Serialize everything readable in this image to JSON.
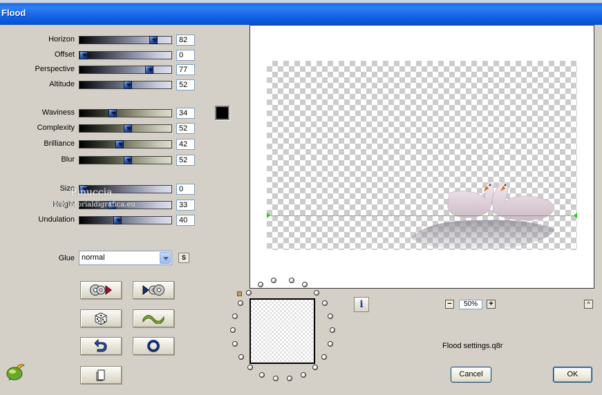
{
  "window": {
    "title": "Flood"
  },
  "sliders": [
    {
      "label": "Horizon",
      "value": "82",
      "level": 82,
      "track": "blue"
    },
    {
      "label": "Offset",
      "value": "0",
      "level": 0,
      "track": "blue"
    },
    {
      "label": "Perspective",
      "value": "77",
      "level": 77,
      "track": "blue"
    },
    {
      "label": "Altitude",
      "value": "52",
      "level": 52,
      "track": "blue"
    },
    {
      "label": "Waviness",
      "value": "34",
      "level": 34,
      "track": "olive"
    },
    {
      "label": "Complexity",
      "value": "52",
      "level": 52,
      "track": "olive"
    },
    {
      "label": "Brilliance",
      "value": "42",
      "level": 42,
      "track": "olive"
    },
    {
      "label": "Blur",
      "value": "52",
      "level": 52,
      "track": "olive"
    },
    {
      "label": "Size",
      "value": "0",
      "level": 0,
      "track": "blue"
    },
    {
      "label": "Height",
      "value": "33",
      "level": 33,
      "track": "blue"
    },
    {
      "label": "Undulation",
      "value": "40",
      "level": 40,
      "track": "blue"
    }
  ],
  "color_swatch": "#000000",
  "watermark": {
    "line1": "Pinuccia",
    "line2": "www.tutorialdigrafica.eu"
  },
  "glue": {
    "label": "Glue",
    "value": "normal",
    "s_button": "S"
  },
  "preview": {
    "zoom": "50%",
    "zoom_minus": "−",
    "zoom_plus": "+",
    "up": "^",
    "info": "i"
  },
  "settings_file": "Flood settings.q8r",
  "buttons": {
    "cancel": "Cancel",
    "ok": "OK"
  }
}
